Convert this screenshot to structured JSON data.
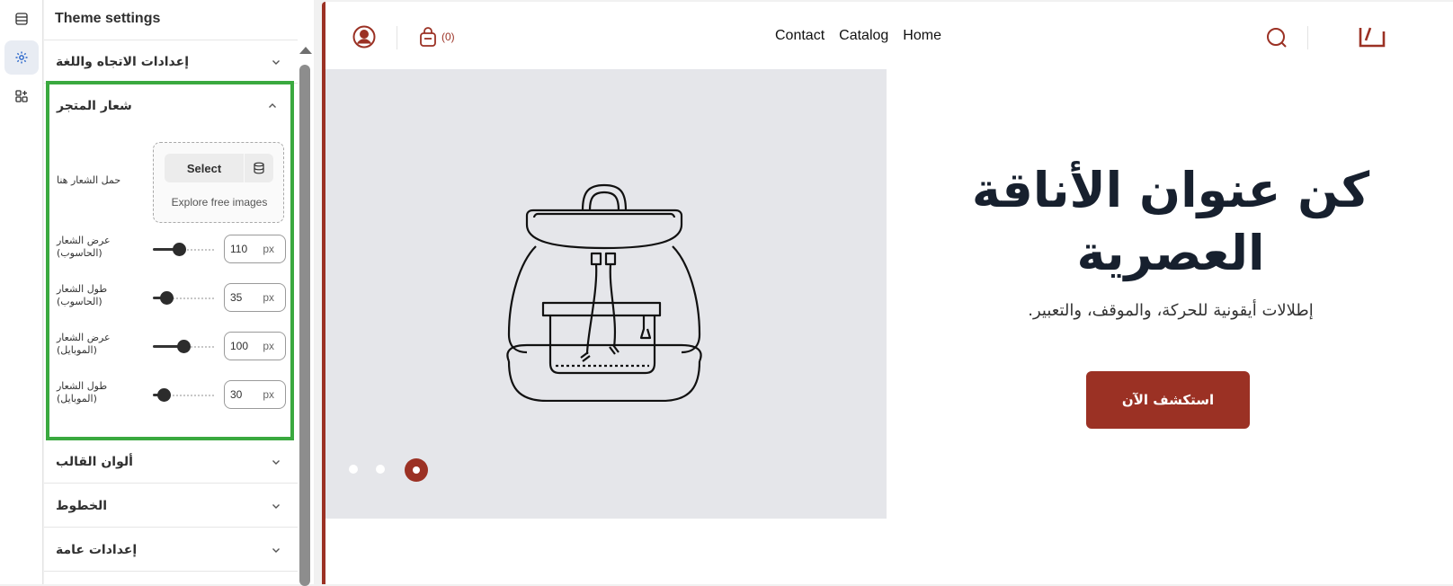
{
  "panel": {
    "title": "Theme settings"
  },
  "sections": {
    "direction_language": "إعدادات الاتجاه واللغة",
    "store_logo": "شعار المتجر",
    "theme_colors": "ألوان القالب",
    "fonts": "الخطوط",
    "general": "إعدادات عامة"
  },
  "logo": {
    "upload_label": "حمل الشعار هنا",
    "select_label": "Select",
    "explore_label": "Explore free images",
    "sliders": [
      {
        "label_line1": "عرض الشعار",
        "label_line2": "(الحاسوب)",
        "value": "110",
        "unit": "px",
        "fraction": 0.42
      },
      {
        "label_line1": "طول الشعار",
        "label_line2": "(الحاسوب)",
        "value": "35",
        "unit": "px",
        "fraction": 0.22
      },
      {
        "label_line1": "عرض الشعار",
        "label_line2": "(الموبايل)",
        "value": "100",
        "unit": "px",
        "fraction": 0.5
      },
      {
        "label_line1": "طول الشعار",
        "label_line2": "(الموبايل)",
        "value": "30",
        "unit": "px",
        "fraction": 0.17
      }
    ]
  },
  "preview": {
    "cart_count": "(0)",
    "nav_links": [
      "Contact",
      "Catalog",
      "Home"
    ],
    "hero_title_line1": "كن عنوان الأناقة",
    "hero_title_line2": "العصرية",
    "hero_subtitle": "إطلالات أيقونية للحركة، والموقف، والتعبير.",
    "hero_cta": "استكشف الآن",
    "accent_color": "#9b3124"
  }
}
